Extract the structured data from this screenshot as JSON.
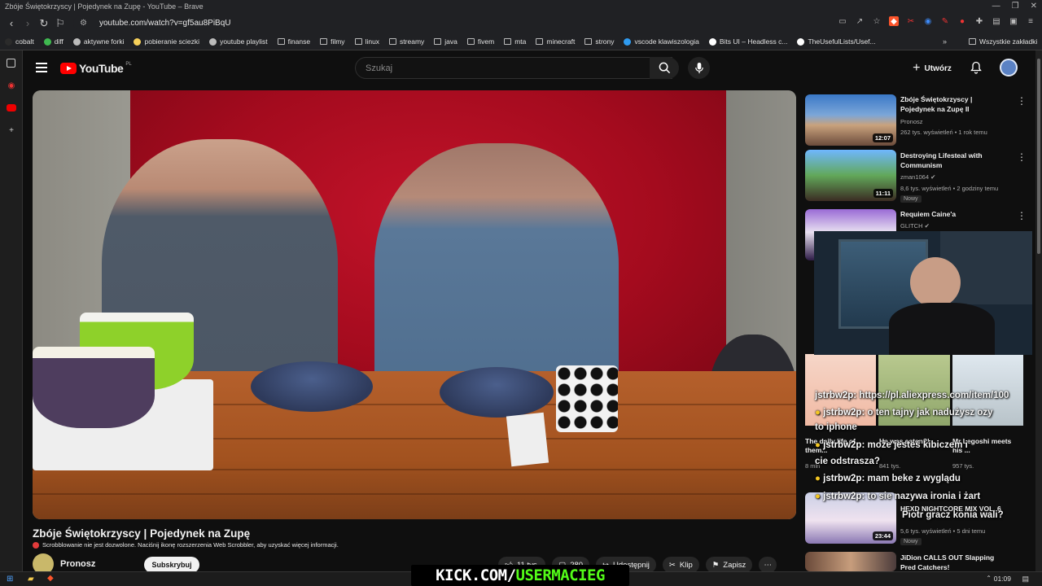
{
  "window": {
    "title": "Zbóje Świętokrzyscy | Pojedynek na Zupę - YouTube – Brave"
  },
  "browser": {
    "url": "youtube.com/watch?v=gf5au8PiBqU"
  },
  "bookmarks": [
    {
      "label": "cobalt",
      "icon": "cobalt-icon",
      "color": "#2b2b2b"
    },
    {
      "label": "diff",
      "icon": "diff-icon",
      "color": "#3fb950"
    },
    {
      "label": "aktywne forki",
      "icon": "fork-icon",
      "color": "#bbbbbb"
    },
    {
      "label": "pobieranie sciezki",
      "icon": "download-icon",
      "color": "#f6d05a"
    },
    {
      "label": "youtube playlist",
      "icon": "globe-icon",
      "color": "#bbbbbb"
    },
    {
      "label": "finanse",
      "icon": "folder-icon",
      "color": "#bbbbbb"
    },
    {
      "label": "filmy",
      "icon": "folder-icon",
      "color": "#bbbbbb"
    },
    {
      "label": "linux",
      "icon": "folder-icon",
      "color": "#bbbbbb"
    },
    {
      "label": "streamy",
      "icon": "folder-icon",
      "color": "#bbbbbb"
    },
    {
      "label": "java",
      "icon": "folder-icon",
      "color": "#bbbbbb"
    },
    {
      "label": "fivem",
      "icon": "folder-icon",
      "color": "#bbbbbb"
    },
    {
      "label": "mta",
      "icon": "folder-icon",
      "color": "#bbbbbb"
    },
    {
      "label": "minecraft",
      "icon": "folder-icon",
      "color": "#bbbbbb"
    },
    {
      "label": "strony",
      "icon": "folder-icon",
      "color": "#bbbbbb"
    },
    {
      "label": "vscode klawiszologia",
      "icon": "vscode-icon",
      "color": "#2f9bf0"
    },
    {
      "label": "Bits UI – Headless c...",
      "icon": "bits-icon",
      "color": "#ffffff"
    },
    {
      "label": "TheUsefulLists/Usef...",
      "icon": "github-icon",
      "color": "#ffffff"
    }
  ],
  "all_bookmarks": "Wszystkie zakładki",
  "header": {
    "search_placeholder": "Szukaj",
    "create_label": "Utwórz",
    "logo_text": "YouTube",
    "logo_region": "PL"
  },
  "video": {
    "title": "Zbóje Świętokrzyscy | Pojedynek na Zupę",
    "scrobbler_notice": "Scrobblowanie nie jest dozwolone. Naciśnij ikonę rozszerzenia Web Scrobbler, aby uzyskać więcej informacji.",
    "channel": "Pronosz",
    "subscribe_label": "Subskrybuj",
    "actions": {
      "like": "11 tys.",
      "comments": "280",
      "share": "Udostępnij",
      "clip": "Klip",
      "save": "Zapisz"
    }
  },
  "sidebar": [
    {
      "title_l1": "Zbóje Świętokrzyscy |",
      "title_l2": "Pojedynek na Zupę II",
      "channel": "Pronosz",
      "meta": "262 tys. wyświetleń • 1 rok temu",
      "duration": "12:07",
      "badge": ""
    },
    {
      "title_l1": "Destroying Lifesteal with",
      "title_l2": "Communism",
      "channel": "zman1064",
      "meta": "8,6 tys. wyświetleń • 2 godziny temu",
      "duration": "11:11",
      "badge": "Nowy"
    },
    {
      "title_l1": "Requiem Caine'a",
      "title_l2": "",
      "channel": "GLITCH",
      "meta": "",
      "duration": "",
      "badge": ""
    },
    {
      "title_l1": "HEXD NIGHTCORE MIX VOL. 6",
      "title_l2": "",
      "channel": "",
      "meta": "5,6 tys. wyświetleń • 5 dni temu",
      "duration": "23:44",
      "badge": "Nowy"
    },
    {
      "title_l1": "JiDion CALLS OUT Slapping",
      "title_l2": "Pred Catchers!",
      "channel": "",
      "meta": "",
      "duration": "",
      "badge": ""
    }
  ],
  "shorts_strip": [
    {
      "title": "The daily life of them...",
      "meta": "8 mln"
    },
    {
      "title": "He was eaten?!",
      "meta": "841 tys."
    },
    {
      "title": "Mr Legoshi meets his ...",
      "meta": "957 tys."
    }
  ],
  "chat_overlay": [
    {
      "user": "jstrbw2p:",
      "text": "https://pl.aliexpress.com/item/100"
    },
    {
      "user": "jstrbw2p:",
      "text": "o ten tajny jak nadużysz ozy"
    },
    {
      "user": "",
      "text": "to iphone"
    },
    {
      "user": "jstrbw2p:",
      "text": "może jesteś kibiczem i"
    },
    {
      "user": "",
      "text": "cie odstrasza?"
    },
    {
      "user": "jstrbw2p:",
      "text": "mam beke z wyglądu"
    },
    {
      "user": "jstrbw2p:",
      "text": "to sie nazywa ironia i żart"
    },
    {
      "user": "",
      "text": "Piotr gracz konia wali?"
    }
  ],
  "stream_banner": {
    "prefix": "KICK.COM/",
    "user": "USERMACIEG",
    "prefix_color": "#ffffff",
    "user_color": "#53fc18"
  },
  "taskbar": {
    "time": "01:09"
  }
}
